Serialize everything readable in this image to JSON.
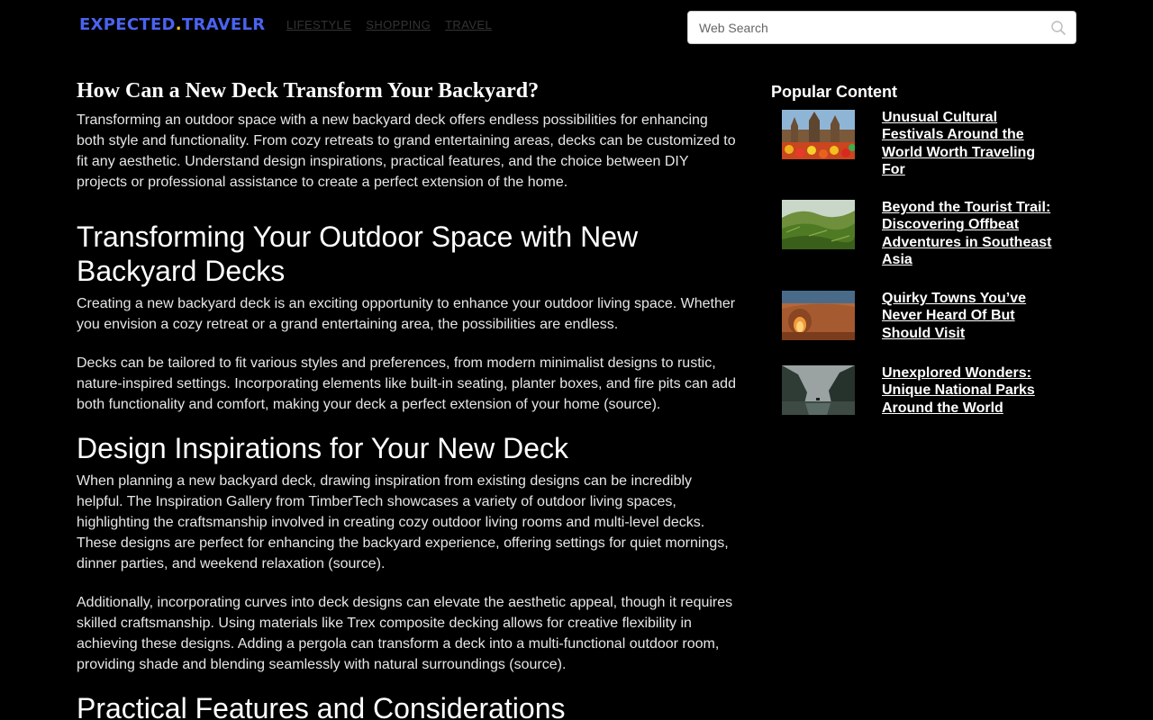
{
  "header": {
    "logo_main": "EXPECTED",
    "logo_dot": ".",
    "logo_suffix": "TRAVELR",
    "nav": [
      {
        "label": "LIFESTYLE"
      },
      {
        "label": "SHOPPING"
      },
      {
        "label": "TRAVEL"
      }
    ],
    "search": {
      "placeholder": "Web Search",
      "icon": "search-icon"
    }
  },
  "article": {
    "title": "How Can a New Deck Transform Your Backyard?",
    "intro": "Transforming an outdoor space with a new backyard deck offers endless possibilities for enhancing both style and functionality. From cozy retreats to grand entertaining areas, decks can be customized to fit any aesthetic. Understand design inspirations, practical features, and the choice between DIY projects or professional assistance to create a perfect extension of the home.",
    "sections": [
      {
        "heading": "Transforming Your Outdoor Space with New Backyard Decks",
        "paragraphs": [
          {
            "text": "Creating a new backyard deck is an exciting opportunity to enhance your outdoor living space. Whether you envision a cozy retreat or a grand entertaining area, the possibilities are endless."
          },
          {
            "text": "Decks can be tailored to fit various styles and preferences, from modern minimalist designs to rustic, nature-inspired settings. Incorporating elements like built-in seating, planter boxes, and fire pits can add both functionality and comfort, making your deck a perfect extension of your home (",
            "link": "source",
            "after": ")."
          }
        ]
      },
      {
        "heading": "Design Inspirations for Your New Deck",
        "paragraphs": [
          {
            "text": "When planning a new backyard deck, drawing inspiration from existing designs can be incredibly helpful. The Inspiration Gallery from TimberTech showcases a variety of outdoor living spaces, highlighting the craftsmanship involved in creating cozy outdoor living rooms and multi-level decks. These designs are perfect for enhancing the backyard experience, offering settings for quiet mornings, dinner parties, and weekend relaxation (",
            "link": "source",
            "after": ")."
          },
          {
            "text": "Additionally, incorporating curves into deck designs can elevate the aesthetic appeal, though it requires skilled craftsmanship. Using materials like Trex composite decking allows for creative flexibility in achieving these designs. Adding a pergola can transform a deck into a multi-functional outdoor room, providing shade and blending seamlessly with natural surroundings (",
            "link": "source",
            "after": ")."
          }
        ]
      },
      {
        "heading": "Practical Features and Considerations"
      }
    ]
  },
  "sidebar": {
    "title": "Popular Content",
    "items": [
      {
        "title": "Unusual Cultural Festivals Around the World Worth Traveling For",
        "thumb": "festival-temple-image"
      },
      {
        "title": "Beyond the Tourist Trail: Discovering Offbeat Adventures in Southeast Asia",
        "thumb": "green-valley-image"
      },
      {
        "title": "Quirky Towns You’ve Never Heard Of But Should Visit",
        "thumb": "desert-cave-image"
      },
      {
        "title": "Unexplored Wonders: Unique National Parks Around the World",
        "thumb": "misty-fjord-image"
      }
    ]
  }
}
